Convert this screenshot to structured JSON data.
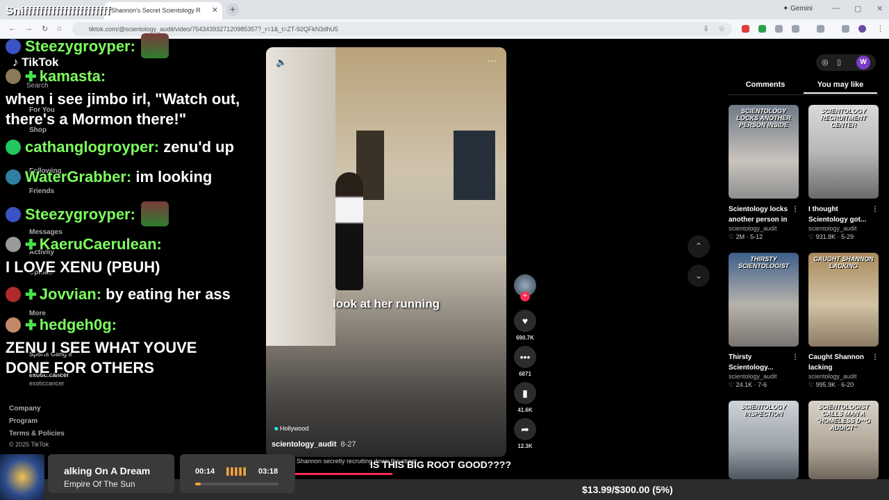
{
  "browser": {
    "tab_title": "Shannon's Secret Scientology R",
    "tab_close": "✕",
    "new_tab": "+",
    "gemini": "✦ Gemini",
    "url": "tiktok.com/@scientology_audit/video/7543439327120985357?_r=1&_t=ZT-92QFkN3dhU5"
  },
  "chat": {
    "title": "Sniffffffffffffffffffffff",
    "messages": [
      {
        "user": "Steezygroyper:",
        "text": ""
      },
      {
        "user": "kamasta:",
        "text": "when i see jimbo irl, \"Watch out, there's a Mormon there!\""
      },
      {
        "user": "cathanglogroyper:",
        "text": "zenu'd up"
      },
      {
        "user": "WaterGrabber:",
        "text": "im looking"
      },
      {
        "user": "Steezygroyper:",
        "text": ""
      },
      {
        "user": "KaeruCaerulean:",
        "text": "I LOVE XENU (PBUH)"
      },
      {
        "user": "Jovvian:",
        "text": "by eating her ass"
      },
      {
        "user": "hedgeh0g:",
        "text": "ZENU I SEE WHAT YOUVE DONE FOR OTHERS"
      }
    ]
  },
  "sidebar": {
    "logo": "TikTok",
    "search": "Search",
    "items": [
      "For You",
      "Shop",
      "Following",
      "Friends",
      "Messages",
      "Activity",
      "Upload",
      "More"
    ],
    "following_1": "Sports Gang 8",
    "following_2": "exotic.cancer",
    "following_2_sub": "exoticcancer",
    "footer": [
      "Company",
      "Program",
      "Terms & Policies"
    ],
    "copyright": "© 2025 TikTok"
  },
  "video": {
    "caption": "look at her running",
    "location": "Hollywood",
    "author": "scientology_audit",
    "date": "8-27",
    "description": "Shannon secretly recruiting down the street",
    "likes": "690.7K",
    "comments": "6871",
    "saves": "41.6K",
    "shares": "12.3K"
  },
  "banner": {
    "text": "IS THIS BIG ROOT GOOD????"
  },
  "right_panel": {
    "tab_comments": "Comments",
    "tab_you_may_like": "You may like",
    "avatar_letter": "W",
    "cards": [
      {
        "thumb_text": "SCIENTOLOGY LOCKS ANOTHER PERSON INSIDE",
        "title": "Scientology locks another person in",
        "author": "scientology_audit",
        "stats": "♡ 2M · 5-12"
      },
      {
        "thumb_text": "SCIENTOLOGY RECRUITMENT CENTER",
        "title": "I thought Scientology got...",
        "author": "scientology_audit",
        "stats": "♡ 931.8K · 5-29"
      },
      {
        "thumb_text": "THIRSTY SCIENTOLOGIST",
        "title": "Thirsty Scientology...",
        "author": "scientology_audit",
        "stats": "♡ 24.1K · 7-6"
      },
      {
        "thumb_text": "CAUGHT SHANNON LACKING",
        "title": "Caught Shannon lacking",
        "author": "scientology_audit",
        "stats": "♡ 995.9K · 6-20"
      },
      {
        "thumb_text": "SCIENTOLOGY INSPECTION",
        "title": "",
        "author": "",
        "stats": ""
      },
      {
        "thumb_text": "SCIENTOLOGIST CALLS MAN A \"HOMELESS D**G ADDICT\"",
        "title": "",
        "author": "",
        "stats": ""
      }
    ]
  },
  "music": {
    "song": "alking On A Dream",
    "artist": "Empire Of The Sun",
    "elapsed": "00:14",
    "duration": "03:18",
    "progress": 0.07
  },
  "donation": "$13.99/$300.00 (5%)",
  "colors": {
    "chat_username": "#7dff5e",
    "tiktok_red": "#fe2c55",
    "music_accent": "#f2a23c"
  }
}
